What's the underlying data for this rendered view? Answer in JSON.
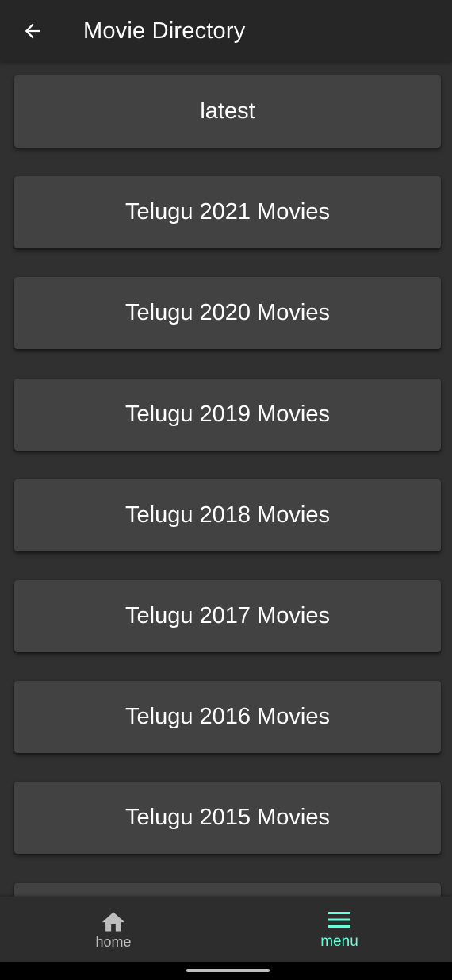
{
  "app_bar": {
    "title": "Movie Directory",
    "back_icon": "arrow-left-icon"
  },
  "list": {
    "items": [
      {
        "label": "latest"
      },
      {
        "label": "Telugu 2021 Movies"
      },
      {
        "label": "Telugu 2020 Movies"
      },
      {
        "label": "Telugu 2019 Movies"
      },
      {
        "label": "Telugu 2018 Movies"
      },
      {
        "label": "Telugu 2017 Movies"
      },
      {
        "label": "Telugu 2016 Movies"
      },
      {
        "label": "Telugu 2015 Movies"
      },
      {
        "label": ""
      }
    ]
  },
  "bottom_nav": {
    "home": {
      "label": "home",
      "icon": "home-icon"
    },
    "menu": {
      "label": "menu",
      "icon": "menu-icon",
      "active": true
    }
  },
  "colors": {
    "background": "#303030",
    "app_bar": "#262626",
    "card": "#424242",
    "accent": "#64ffda",
    "inactive": "#bdbdbd"
  }
}
